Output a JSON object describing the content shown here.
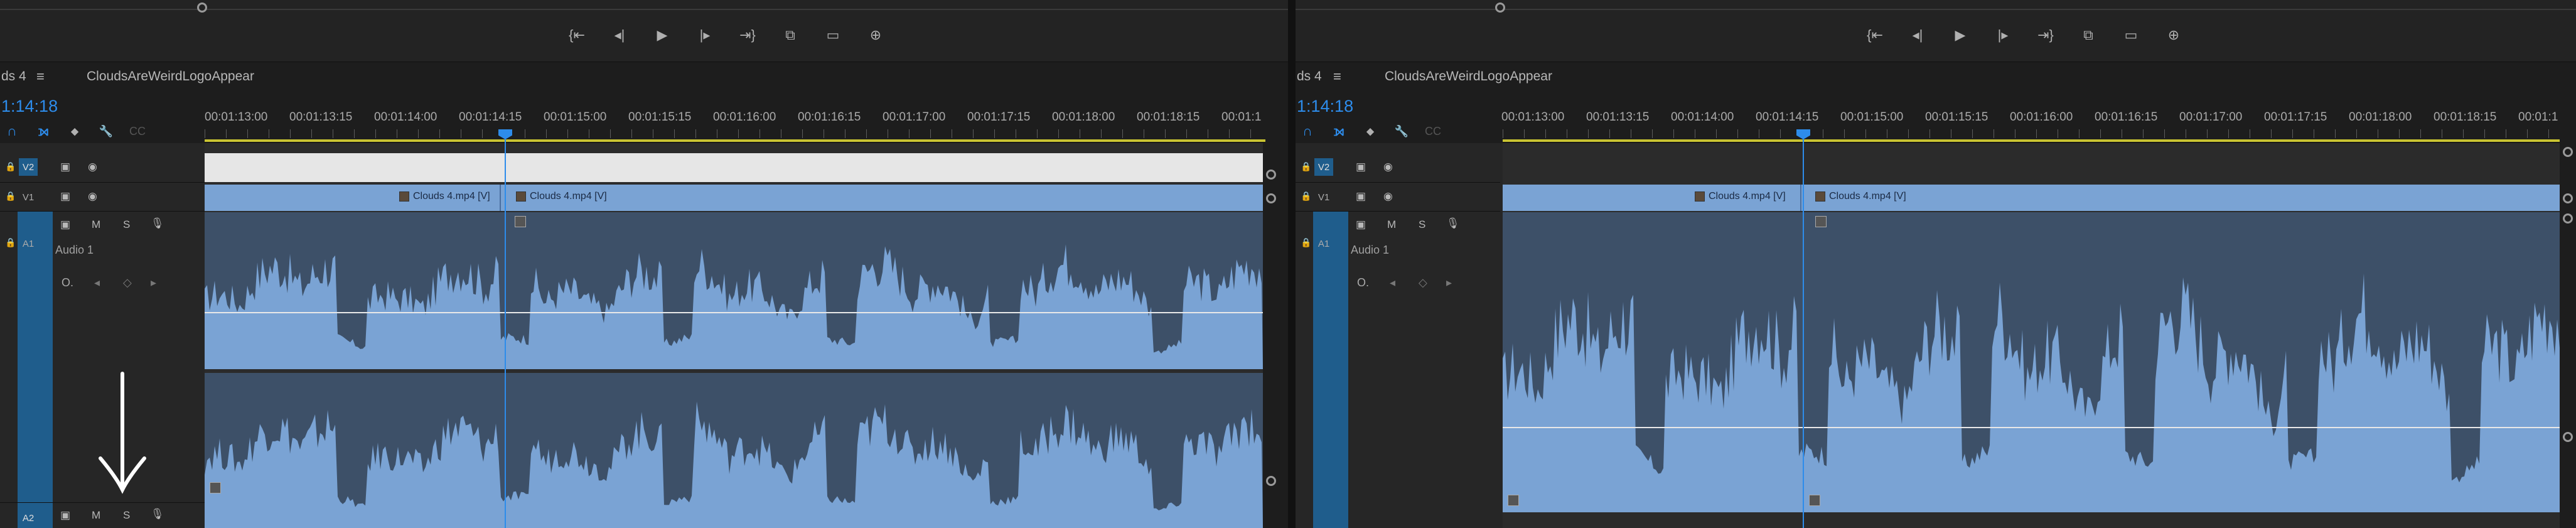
{
  "left": {
    "sequence_tab": "ds 4",
    "sequence_name": "CloudsAreWeirdLogoAppear",
    "timecode": "1:14:18",
    "ruler_labels": [
      "00:01:13:00",
      "00:01:13:15",
      "00:01:14:00",
      "00:01:14:15",
      "00:01:15:00",
      "00:01:15:15",
      "00:01:16:00",
      "00:01:16:15",
      "00:01:17:00",
      "00:01:17:15",
      "00:01:18:00",
      "00:01:18:15",
      "00:01:1"
    ],
    "tracks": {
      "v2": "V2",
      "v1": "V1",
      "a1": "A1",
      "a2": "A2",
      "audio_name": "Audio 1",
      "m": "M",
      "s": "S"
    },
    "clips": {
      "clip_a": "Clouds 4.mp4 [V]",
      "clip_b": "Clouds 4.mp4 [V]"
    }
  },
  "right": {
    "sequence_tab": "ds 4",
    "sequence_name": "CloudsAreWeirdLogoAppear",
    "timecode": "1:14:18",
    "ruler_labels": [
      "00:01:13:00",
      "00:01:13:15",
      "00:01:14:00",
      "00:01:14:15",
      "00:01:15:00",
      "00:01:15:15",
      "00:01:16:00",
      "00:01:16:15",
      "00:01:17:00",
      "00:01:17:15",
      "00:01:18:00",
      "00:01:18:15",
      "00:01:1"
    ],
    "tracks": {
      "v2": "V2",
      "v1": "V1",
      "a1": "A1",
      "audio_name": "Audio 1",
      "m": "M",
      "s": "S"
    },
    "clips": {
      "clip_a": "Clouds 4.mp4 [V]",
      "clip_b": "Clouds 4.mp4 [V]"
    }
  },
  "icons": {
    "menu": "≡",
    "step_back_edit": "{⇤",
    "step_back": "◂|",
    "play": "▶",
    "step_forward": "|▸",
    "step_forward_edit": "⇥}",
    "insert": "⧉",
    "overwrite": "▭",
    "export_frame": "⊕",
    "lock": "🔒",
    "eye": "◉",
    "camera": "▣",
    "mic": "🎙",
    "snap": "∩",
    "linked": "⟕",
    "marker": "⬥",
    "wrench": "🔧",
    "caption": "CC",
    "keyframe": "◇",
    "prev_kf": "◂",
    "next_kf": "▸",
    "knob": "O."
  },
  "colors": {
    "accent": "#2d8ceb",
    "clip_video": "#7aa3d4",
    "audio_bg": "#3d5068",
    "wave": "#7aa3d4",
    "target": "#1f5d8c"
  }
}
